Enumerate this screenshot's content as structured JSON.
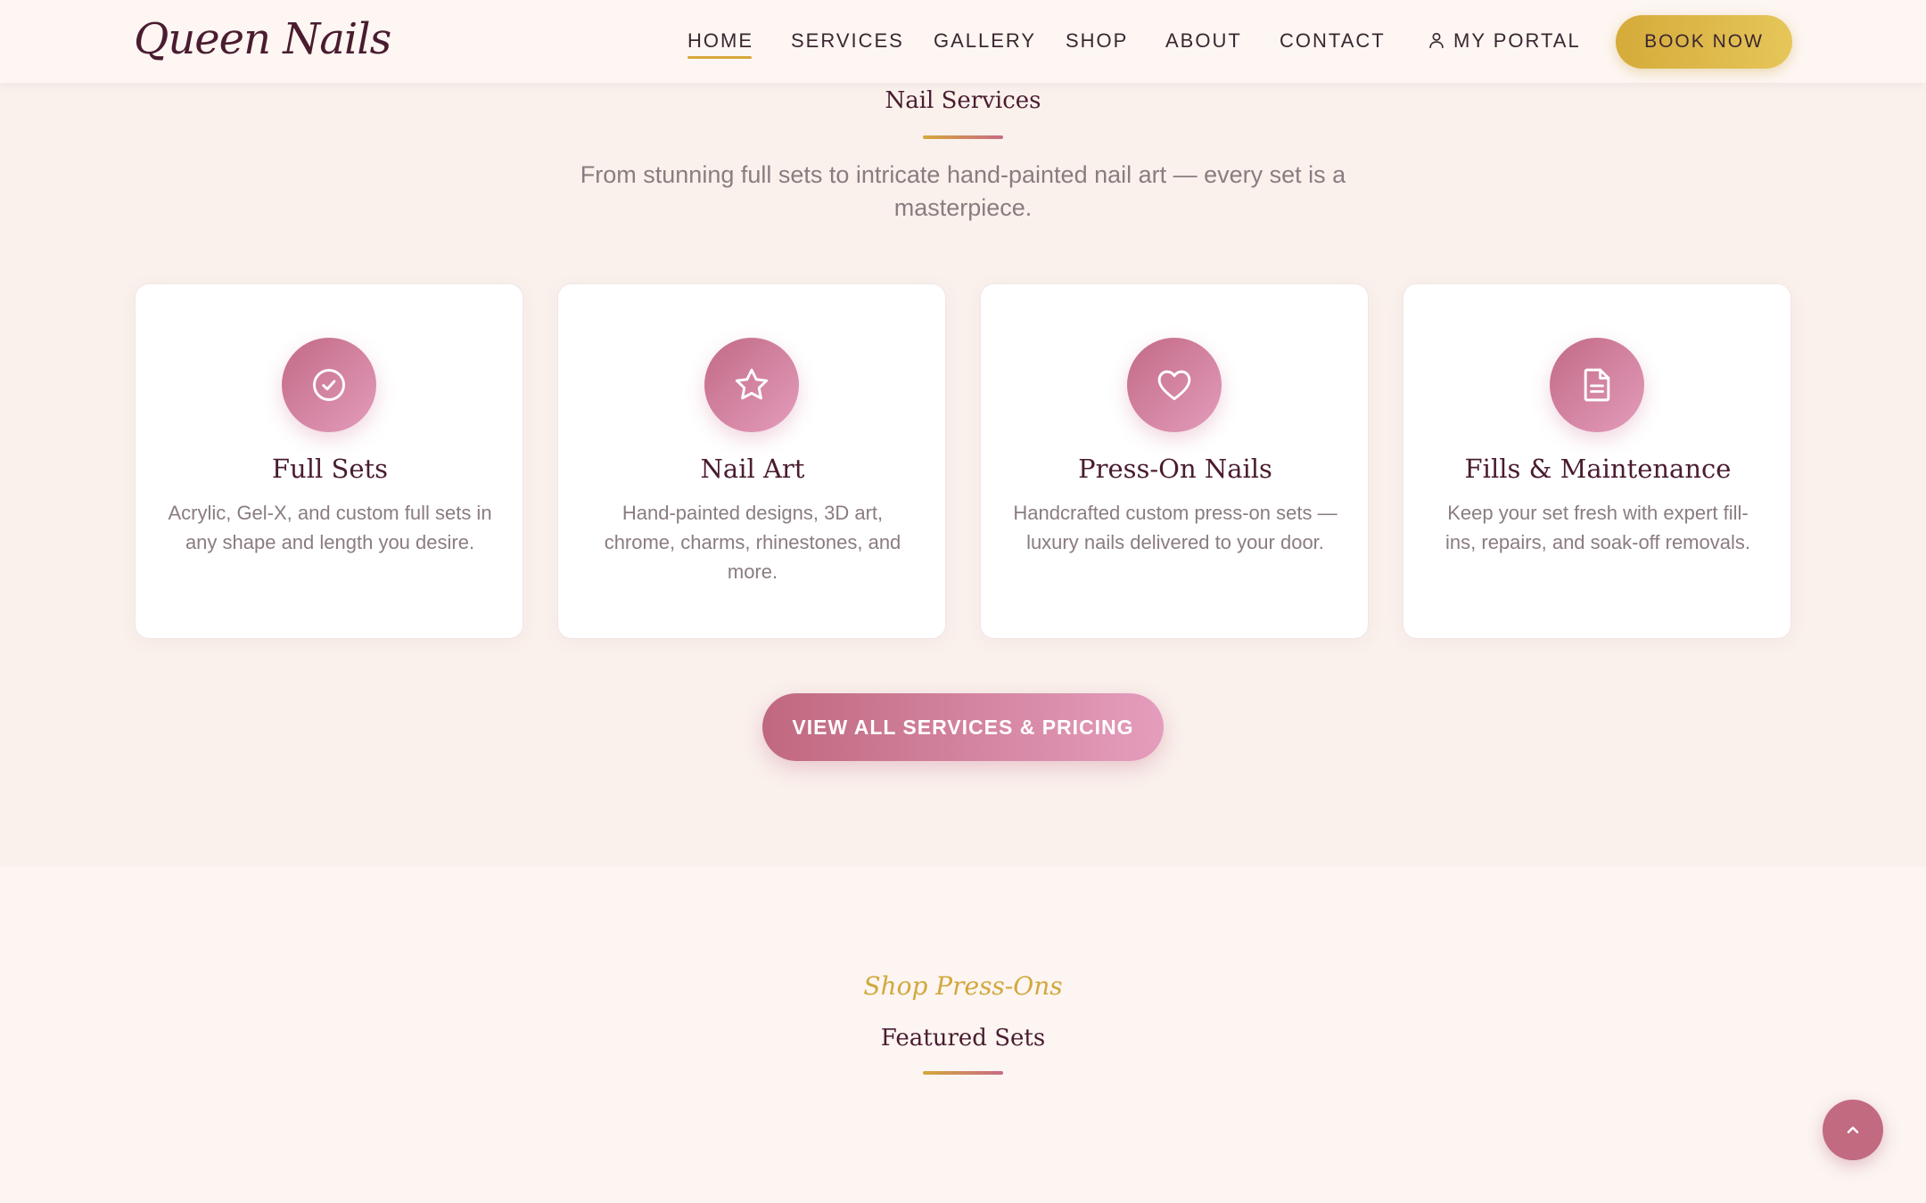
{
  "header": {
    "logo": "Queen Nails",
    "nav": [
      {
        "label": "HOME",
        "active": true
      },
      {
        "label": "SERVICES",
        "active": false
      },
      {
        "label": "GALLERY",
        "active": false
      },
      {
        "label": "SHOP",
        "active": false
      },
      {
        "label": "ABOUT",
        "active": false
      },
      {
        "label": "CONTACT",
        "active": false
      },
      {
        "label": "MY PORTAL",
        "active": false,
        "icon": "user-icon"
      }
    ],
    "book_label": "BOOK NOW"
  },
  "services": {
    "title": "Nail Services",
    "intro": "From stunning full sets to intricate hand-painted nail art — every set is a masterpiece.",
    "cards": [
      {
        "icon": "check-circle-icon",
        "title": "Full Sets",
        "desc": "Acrylic, Gel-X, and custom full sets in any shape and length you desire."
      },
      {
        "icon": "star-icon",
        "title": "Nail Art",
        "desc": "Hand-painted designs, 3D art, chrome, charms, rhinestones, and more."
      },
      {
        "icon": "heart-icon",
        "title": "Press-On Nails",
        "desc": "Handcrafted custom press-on sets — luxury nails delivered to your door."
      },
      {
        "icon": "document-icon",
        "title": "Fills & Maintenance",
        "desc": "Keep your set fresh with expert fill-ins, repairs, and soak-off removals."
      }
    ],
    "cta_label": "VIEW ALL SERVICES & PRICING"
  },
  "shop": {
    "kicker": "Shop Press-Ons",
    "title": "Featured Sets"
  },
  "back_to_top_icon": "chevron-up-icon",
  "colors": {
    "accent_gold": "#d5ab3a",
    "accent_rose": "#c26a86",
    "heading": "#4a1c30",
    "body_text": "#8a7c80",
    "background": "#faf1ec"
  }
}
